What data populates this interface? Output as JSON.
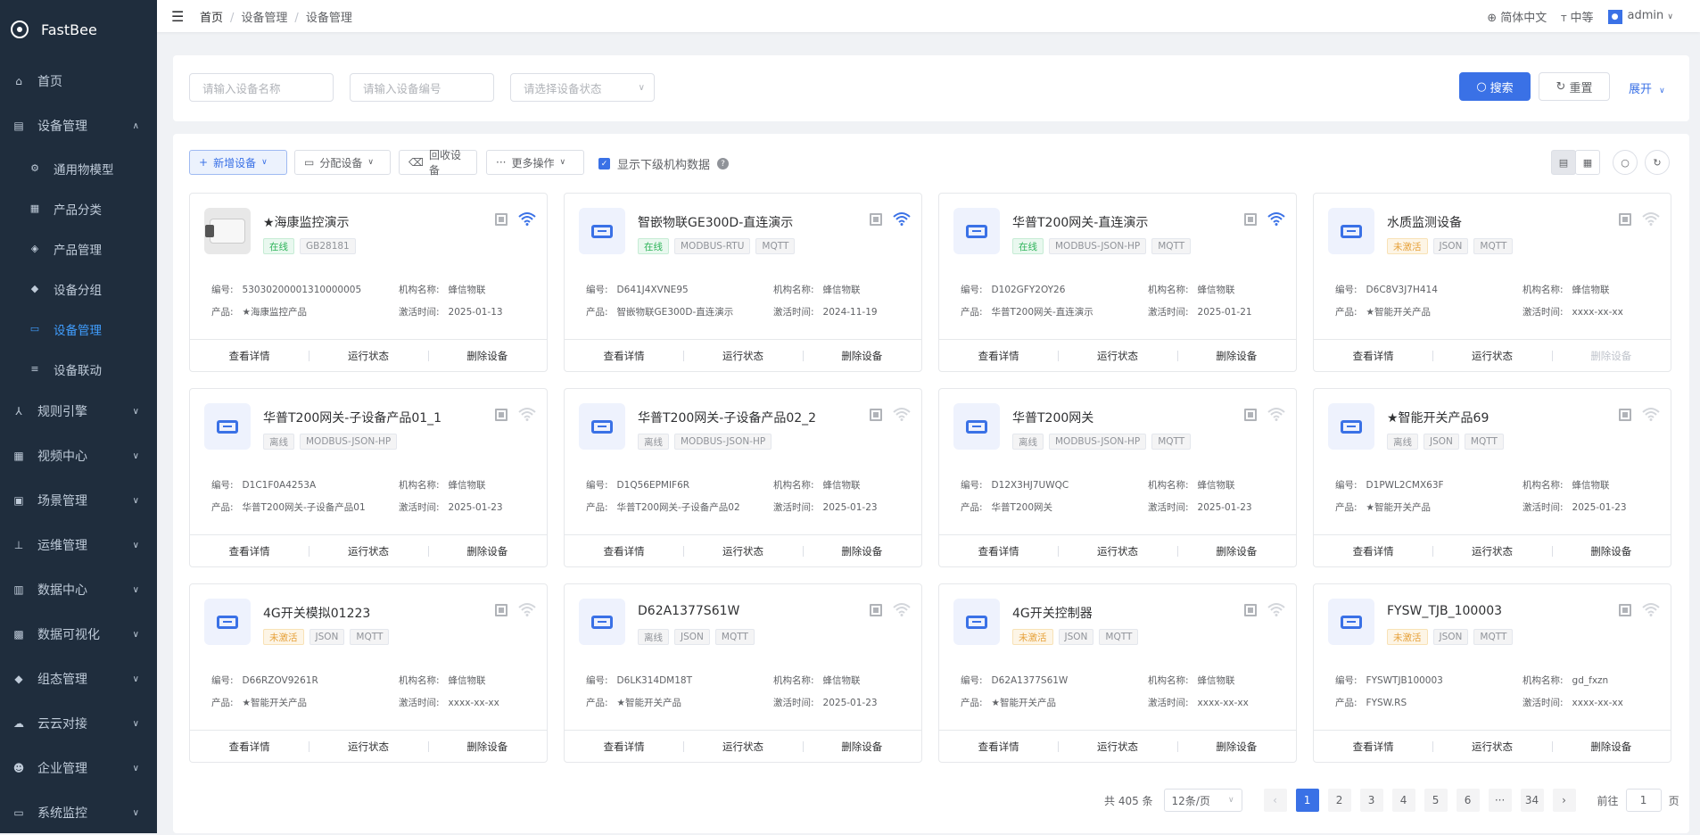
{
  "app": {
    "name": "FastBee"
  },
  "sidebar": {
    "items": [
      {
        "label": "首页",
        "icon": "home-icon",
        "glyph": "⌂"
      },
      {
        "label": "设备管理",
        "icon": "list-icon",
        "glyph": "▤",
        "expanded": true
      },
      {
        "label": "通用物模型",
        "icon": "gear-icon",
        "glyph": "⚙",
        "sub": true
      },
      {
        "label": "产品分类",
        "icon": "grid-icon",
        "glyph": "▦",
        "sub": true
      },
      {
        "label": "产品管理",
        "icon": "cube-icon",
        "glyph": "◈",
        "sub": true
      },
      {
        "label": "设备分组",
        "icon": "layers-icon",
        "glyph": "◆",
        "sub": true
      },
      {
        "label": "设备管理",
        "icon": "device-icon",
        "glyph": "▭",
        "sub": true,
        "active": true
      },
      {
        "label": "设备联动",
        "icon": "linkage-icon",
        "glyph": "≡",
        "sub": true
      },
      {
        "label": "规则引擎",
        "icon": "rule-icon",
        "glyph": "⅄"
      },
      {
        "label": "视频中心",
        "icon": "video-icon",
        "glyph": "▦"
      },
      {
        "label": "场景管理",
        "icon": "scene-icon",
        "glyph": "▣"
      },
      {
        "label": "运维管理",
        "icon": "ops-icon",
        "glyph": "⊥"
      },
      {
        "label": "数据中心",
        "icon": "data-icon",
        "glyph": "▥"
      },
      {
        "label": "数据可视化",
        "icon": "visual-icon",
        "glyph": "▩"
      },
      {
        "label": "组态管理",
        "icon": "config-icon",
        "glyph": "◆"
      },
      {
        "label": "云云对接",
        "icon": "cloud-icon",
        "glyph": "☁"
      },
      {
        "label": "企业管理",
        "icon": "company-icon",
        "glyph": "☻"
      },
      {
        "label": "系统监控",
        "icon": "monitor-icon",
        "glyph": "▭"
      }
    ]
  },
  "topbar": {
    "breadcrumb": [
      "首页",
      "设备管理",
      "设备管理"
    ],
    "language": "简体中文",
    "font_size": "中等",
    "user": "admin"
  },
  "search": {
    "name_placeholder": "请输入设备名称",
    "serial_placeholder": "请输入设备编号",
    "status_placeholder": "请选择设备状态",
    "search_label": "搜索",
    "reset_label": "重置",
    "expand_label": "展开"
  },
  "toolbar": {
    "add": "新增设备",
    "assign": "分配设备",
    "recycle": "回收设备",
    "more": "更多操作",
    "show_sub": "显示下级机构数据"
  },
  "labels": {
    "serial": "编号:",
    "org": "机构名称:",
    "product": "产品:",
    "activation": "激活时间:",
    "view": "查看详情",
    "status": "运行状态",
    "delete": "删除设备"
  },
  "devices": [
    {
      "name": "★海康监控演示",
      "tags": [
        "在线",
        "GB28181"
      ],
      "status": "online",
      "serial": "53030200001310000005",
      "org": "蜂信物联",
      "product": "★海康监控产品",
      "activated": "2025-01-13",
      "wifi": true,
      "camera": true
    },
    {
      "name": "智嵌物联GE300D-直连演示",
      "tags": [
        "在线",
        "MODBUS-RTU",
        "MQTT"
      ],
      "status": "online",
      "serial": "D641J4XVNE95",
      "org": "蜂信物联",
      "product": "智嵌物联GE300D-直连演示",
      "activated": "2024-11-19",
      "wifi": true
    },
    {
      "name": "华普T200网关-直连演示",
      "tags": [
        "在线",
        "MODBUS-JSON-HP",
        "MQTT"
      ],
      "status": "online",
      "serial": "D102GFY2OY26",
      "org": "蜂信物联",
      "product": "华普T200网关-直连演示",
      "activated": "2025-01-21",
      "wifi": true
    },
    {
      "name": "水质监测设备",
      "tags": [
        "未激活",
        "JSON",
        "MQTT"
      ],
      "status": "inactive",
      "serial": "D6C8V3J7H414",
      "org": "蜂信物联",
      "product": "★智能开关产品",
      "activated": "xxxx-xx-xx",
      "wifi": false,
      "delete_disabled": true
    },
    {
      "name": "华普T200网关-子设备产品01_1",
      "tags": [
        "离线",
        "MODBUS-JSON-HP"
      ],
      "status": "offline",
      "serial": "D1C1F0A4253A",
      "org": "蜂信物联",
      "product": "华普T200网关-子设备产品01",
      "activated": "2025-01-23",
      "wifi": false
    },
    {
      "name": "华普T200网关-子设备产品02_2",
      "tags": [
        "离线",
        "MODBUS-JSON-HP"
      ],
      "status": "offline",
      "serial": "D1Q56EPMIF6R",
      "org": "蜂信物联",
      "product": "华普T200网关-子设备产品02",
      "activated": "2025-01-23",
      "wifi": false
    },
    {
      "name": "华普T200网关",
      "tags": [
        "离线",
        "MODBUS-JSON-HP",
        "MQTT"
      ],
      "status": "offline",
      "serial": "D12X3HJ7UWQC",
      "org": "蜂信物联",
      "product": "华普T200网关",
      "activated": "2025-01-23",
      "wifi": false
    },
    {
      "name": "★智能开关产品69",
      "tags": [
        "离线",
        "JSON",
        "MQTT"
      ],
      "status": "offline",
      "serial": "D1PWL2CMX63F",
      "org": "蜂信物联",
      "product": "★智能开关产品",
      "activated": "2025-01-23",
      "wifi": false
    },
    {
      "name": "4G开关模拟01223",
      "tags": [
        "未激活",
        "JSON",
        "MQTT"
      ],
      "status": "inactive",
      "serial": "D66RZOV9261R",
      "org": "蜂信物联",
      "product": "★智能开关产品",
      "activated": "xxxx-xx-xx",
      "wifi": false
    },
    {
      "name": "D62A1377S61W",
      "tags": [
        "离线",
        "JSON",
        "MQTT"
      ],
      "status": "offline",
      "serial": "D6LK314DM18T",
      "org": "蜂信物联",
      "product": "★智能开关产品",
      "activated": "2025-01-23",
      "wifi": false
    },
    {
      "name": "4G开关控制器",
      "tags": [
        "未激活",
        "JSON",
        "MQTT"
      ],
      "status": "inactive",
      "serial": "D62A1377S61W",
      "org": "蜂信物联",
      "product": "★智能开关产品",
      "activated": "xxxx-xx-xx",
      "wifi": false
    },
    {
      "name": "FYSW_TJB_100003",
      "tags": [
        "未激活",
        "JSON",
        "MQTT"
      ],
      "status": "inactive",
      "serial": "FYSWTJB100003",
      "org": "gd_fxzn",
      "product": "FYSW.RS",
      "activated": "xxxx-xx-xx",
      "wifi": false
    }
  ],
  "pagination": {
    "total": "共 405 条",
    "page_size": "12条/页",
    "pages": [
      "1",
      "2",
      "3",
      "4",
      "5",
      "6",
      "···",
      "34"
    ],
    "current": "1",
    "goto_label": "前往",
    "goto_value": "1",
    "page_suffix": "页"
  },
  "colors": {
    "primary": "#3a71e6",
    "sidebar": "#1f2d3d",
    "online": "#2fb45a",
    "inactive": "#e6a23c"
  }
}
